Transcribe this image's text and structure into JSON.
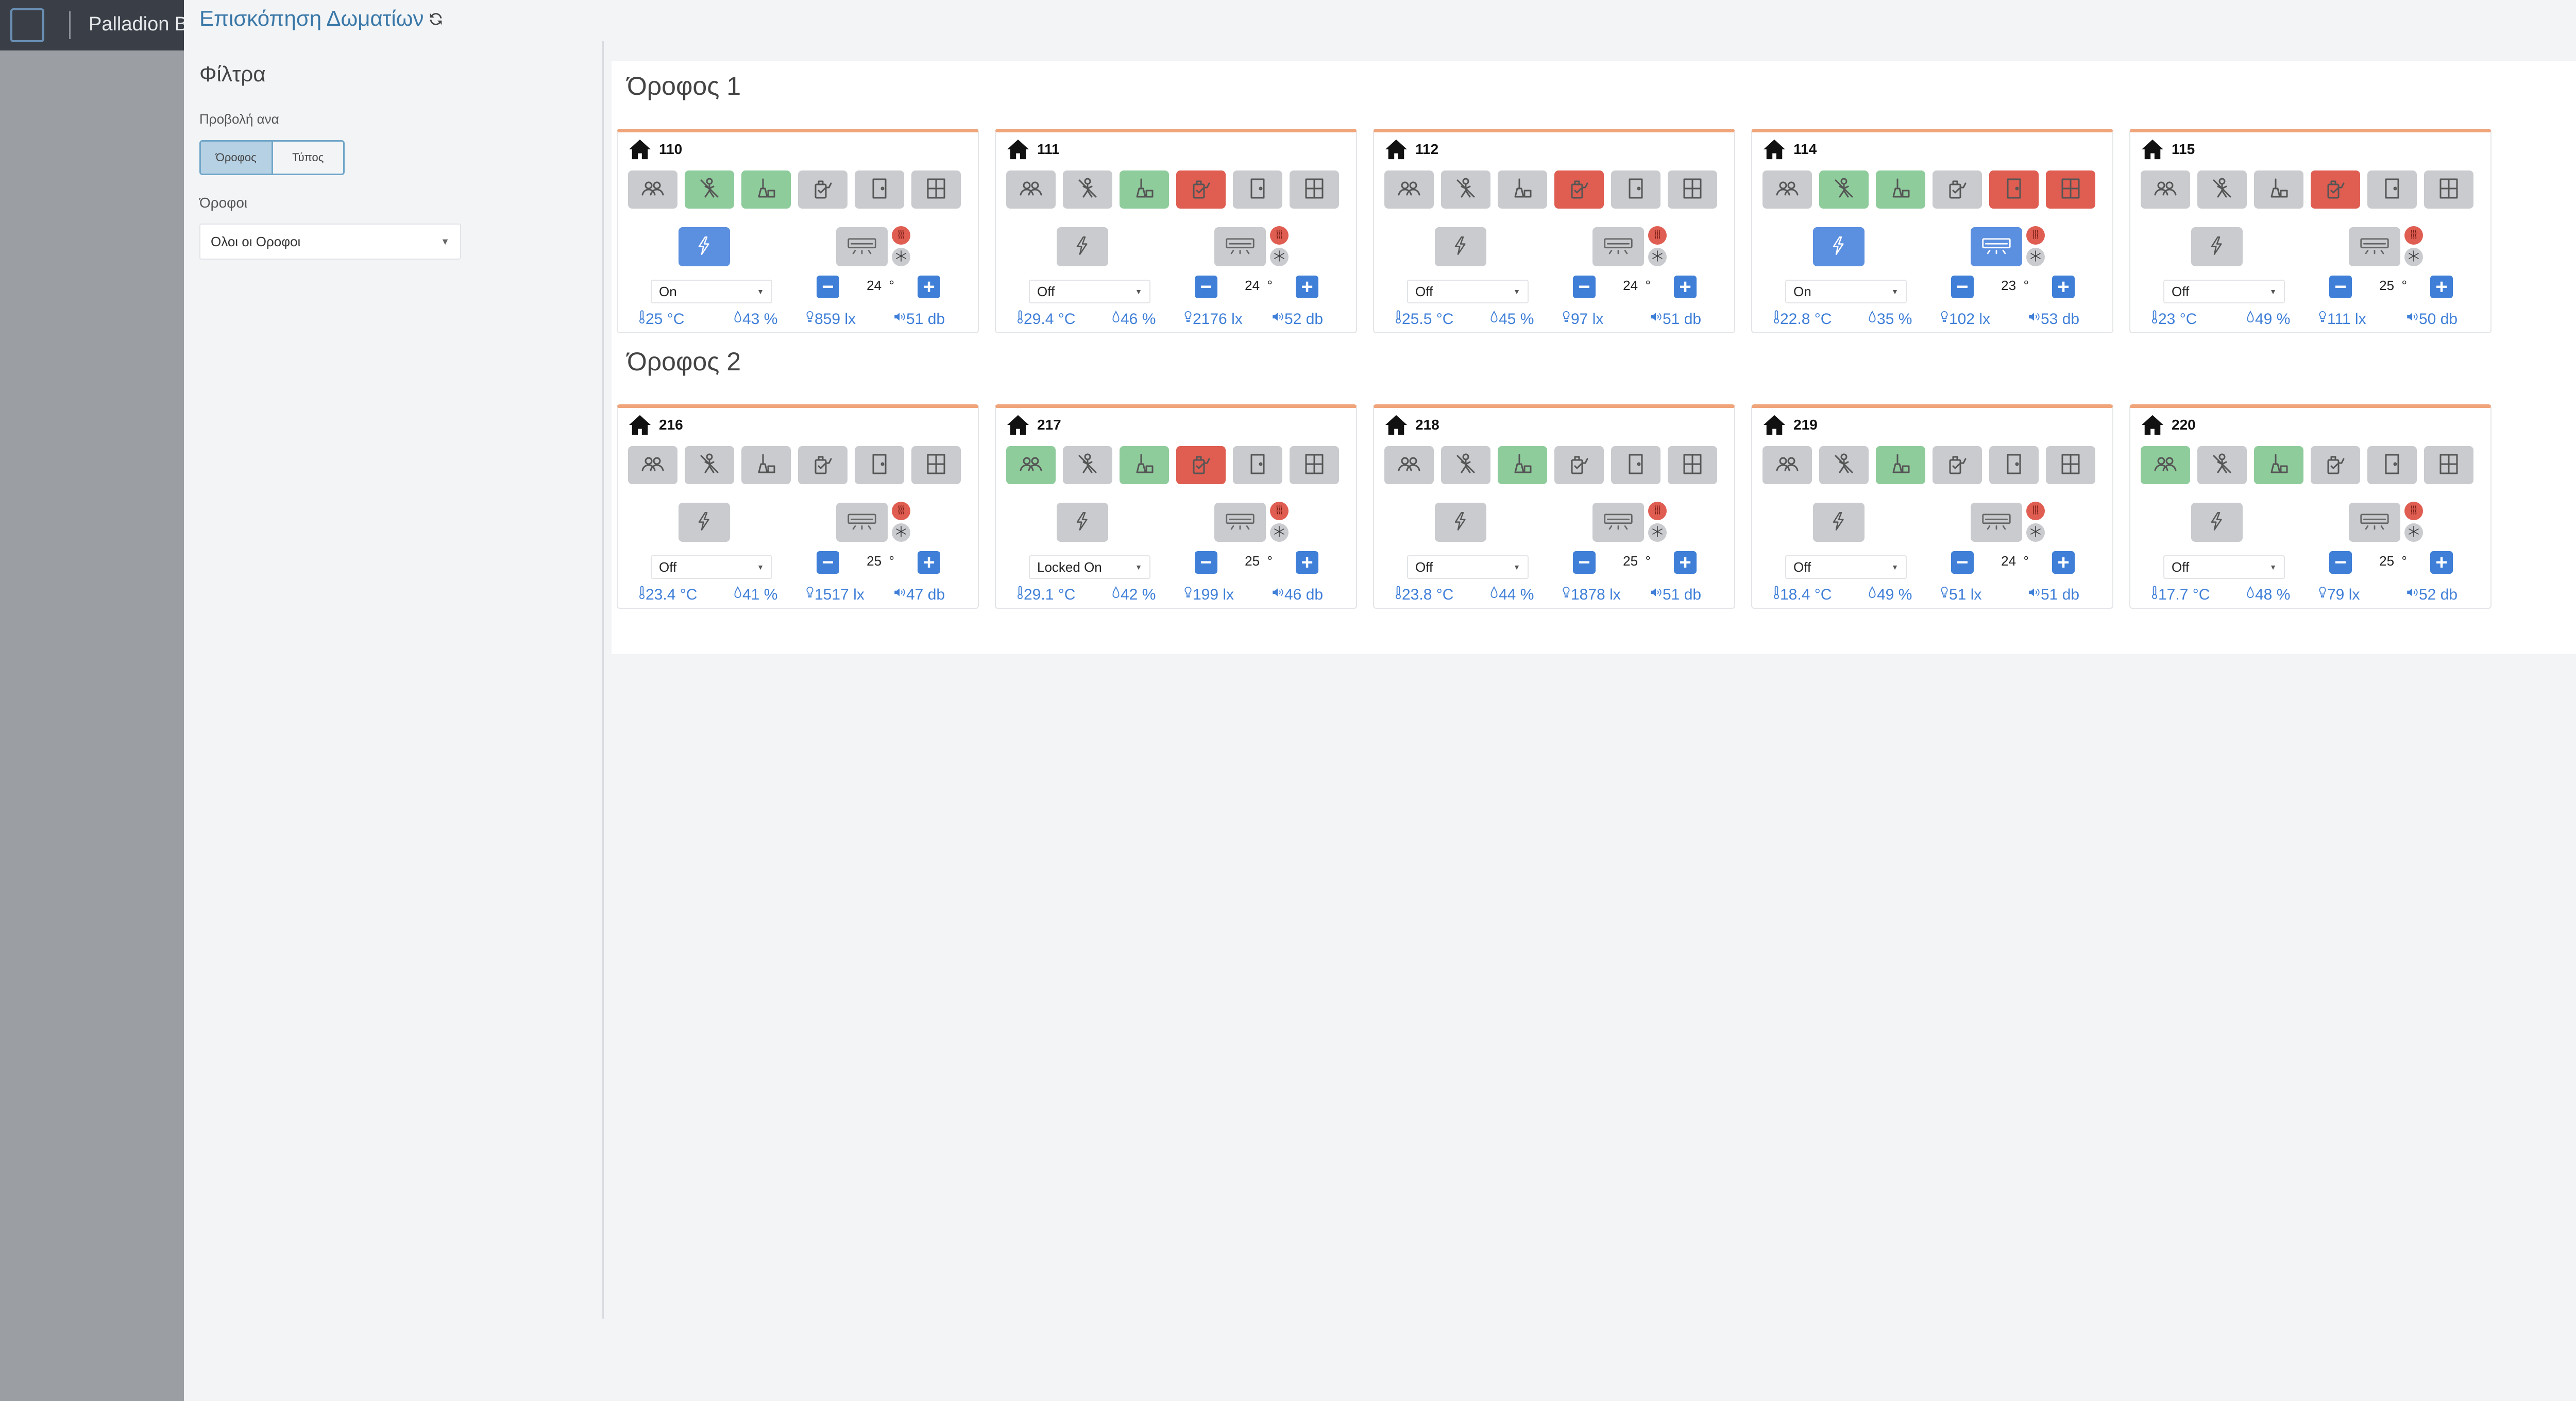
{
  "background": {
    "brand": "Palladion B"
  },
  "modal": {
    "title": "Επισκόπηση Δωματίων",
    "close": "×"
  },
  "filters": {
    "title": "Φίλτρα",
    "view_by_label": "Προβολή ανα",
    "view_options": [
      "Όροφος",
      "Τύπος"
    ],
    "view_selected": "Όροφος",
    "floors_label": "Όροφοι",
    "floors_value": "Ολοι οι Οροφοι"
  },
  "colors": {
    "accent": "#3f7fd8",
    "active": "#8fcc9c",
    "alert": "#df5d51",
    "inactive": "#c9cbce",
    "header_border": "#f0a47a"
  },
  "status_icons": [
    "occupancy-icon",
    "do-not-disturb-icon",
    "cleaning-icon",
    "service-call-icon",
    "door-icon",
    "window-icon"
  ],
  "power_options": [
    "On",
    "Off",
    "Locked On"
  ],
  "units": {
    "degree": "°"
  },
  "floors": [
    {
      "title": "Όροφος 1",
      "rooms": [
        {
          "number": "110",
          "status": [
            "",
            "g",
            "g",
            "",
            "",
            ""
          ],
          "power_on": true,
          "ac_on": false,
          "power": "On",
          "setpoint": "24",
          "temp": "25 °C",
          "humidity": "43 %",
          "light": "859 lx",
          "sound": "51 db"
        },
        {
          "number": "111",
          "status": [
            "",
            "",
            "g",
            "r",
            "",
            ""
          ],
          "power_on": false,
          "ac_on": false,
          "power": "Off",
          "setpoint": "24",
          "temp": "29.4 °C",
          "humidity": "46 %",
          "light": "2176 lx",
          "sound": "52 db"
        },
        {
          "number": "112",
          "status": [
            "",
            "",
            "",
            "r",
            "",
            ""
          ],
          "power_on": false,
          "ac_on": false,
          "power": "Off",
          "setpoint": "24",
          "temp": "25.5 °C",
          "humidity": "45 %",
          "light": "97 lx",
          "sound": "51 db"
        },
        {
          "number": "114",
          "status": [
            "",
            "g",
            "g",
            "",
            "r",
            "r"
          ],
          "power_on": true,
          "ac_on": true,
          "power": "On",
          "setpoint": "23",
          "temp": "22.8 °C",
          "humidity": "35 %",
          "light": "102 lx",
          "sound": "53 db"
        },
        {
          "number": "115",
          "status": [
            "",
            "",
            "",
            "r",
            "",
            ""
          ],
          "power_on": false,
          "ac_on": false,
          "power": "Off",
          "setpoint": "25",
          "temp": "23 °C",
          "humidity": "49 %",
          "light": "111 lx",
          "sound": "50 db"
        }
      ]
    },
    {
      "title": "Όροφος 2",
      "rooms": [
        {
          "number": "216",
          "status": [
            "",
            "",
            "",
            "",
            "",
            ""
          ],
          "power_on": false,
          "ac_on": false,
          "power": "Off",
          "setpoint": "25",
          "temp": "23.4 °C",
          "humidity": "41 %",
          "light": "1517 lx",
          "sound": "47 db"
        },
        {
          "number": "217",
          "status": [
            "g",
            "",
            "g",
            "r",
            "",
            ""
          ],
          "power_on": false,
          "ac_on": false,
          "power": "Locked On",
          "setpoint": "25",
          "temp": "29.1 °C",
          "humidity": "42 %",
          "light": "199 lx",
          "sound": "46 db"
        },
        {
          "number": "218",
          "status": [
            "",
            "",
            "g",
            "",
            "",
            ""
          ],
          "power_on": false,
          "ac_on": false,
          "power": "Off",
          "setpoint": "25",
          "temp": "23.8 °C",
          "humidity": "44 %",
          "light": "1878 lx",
          "sound": "51 db"
        },
        {
          "number": "219",
          "status": [
            "",
            "",
            "g",
            "",
            "",
            ""
          ],
          "power_on": false,
          "ac_on": false,
          "power": "Off",
          "setpoint": "24",
          "temp": "18.4 °C",
          "humidity": "49 %",
          "light": "51 lx",
          "sound": "51 db"
        },
        {
          "number": "220",
          "status": [
            "g",
            "",
            "g",
            "",
            "",
            ""
          ],
          "power_on": false,
          "ac_on": false,
          "power": "Off",
          "setpoint": "25",
          "temp": "17.7 °C",
          "humidity": "48 %",
          "light": "79 lx",
          "sound": "52 db"
        }
      ]
    }
  ]
}
